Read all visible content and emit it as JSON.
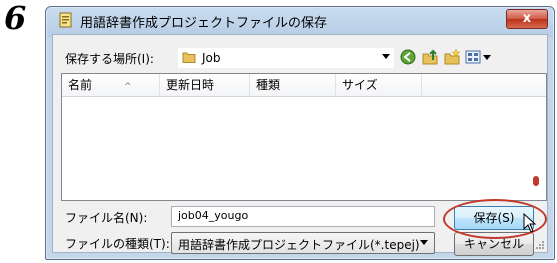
{
  "step_number": "6",
  "dialog": {
    "title": "用語辞書作成プロジェクトファイルの保存",
    "close_label": "x"
  },
  "location": {
    "label": "保存する場所(I):",
    "value": "Job"
  },
  "toolbar_icons": [
    "back-icon",
    "up-folder-icon",
    "new-folder-icon",
    "view-menu-icon"
  ],
  "columns": [
    {
      "label": "名前"
    },
    {
      "label": "更新日時"
    },
    {
      "label": "種類"
    },
    {
      "label": "サイズ"
    }
  ],
  "filename": {
    "label": "ファイル名(N):",
    "value": "job04_yougo"
  },
  "filetype": {
    "label": "ファイルの種類(T):",
    "value": "用語辞書作成プロジェクトファイル(*.tepej)"
  },
  "buttons": {
    "save": "保存(S)",
    "cancel": "キャンセル"
  },
  "colors": {
    "highlight": "#c0392b",
    "close": "#cf5a45"
  }
}
